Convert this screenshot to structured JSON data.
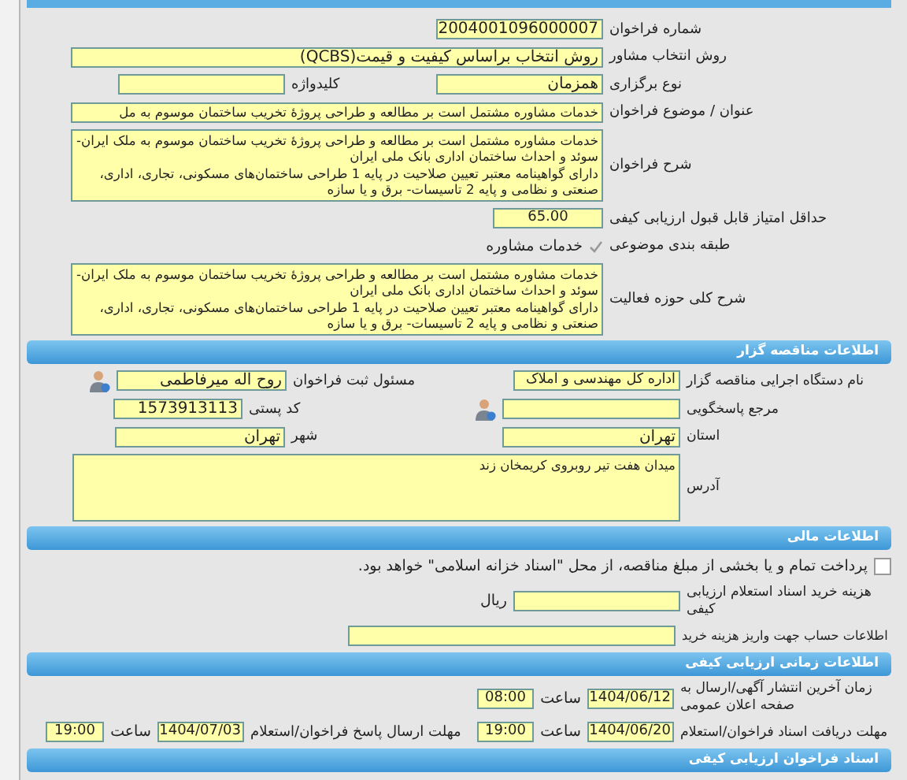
{
  "announcement": {
    "number": {
      "label": "شماره فراخوان",
      "value": "2004001096000007"
    },
    "selection_method": {
      "label": "روش انتخاب مشاور",
      "value": "روش انتخاب براساس کیفیت و قیمت(QCBS)"
    },
    "holding_type": {
      "label": "نوع برگزاری",
      "value": "همزمان"
    },
    "keyword": {
      "label": "کلیدواژه"
    },
    "subject": {
      "label": "عنوان / موضوع فراخوان",
      "value": "خدمات مشاوره مشتمل است بر مطالعه و طراحی پروژهٔ تخریب ساختمان موسوم به مل"
    },
    "description": {
      "label": "شرح فراخوان",
      "paragraphs": [
        "خدمات مشاوره مشتمل است بر مطالعه و طراحی پروژهٔ تخریب ساختمان موسوم به ملک ایران-سوئد و احداث ساختمان اداری بانک ملی ایران",
        "دارای گواهینامه معتبر تعیین صلاحیت در پایه 1 طراحی ساختمان‌های مسکونی، تجاری، اداری، صنعتی و نظامی و پایه 2 تاسیسات- برق و یا سازه"
      ]
    },
    "min_score": {
      "label": "حداقل امتیاز قابل قبول ارزیابی کیفی",
      "value": "65.00"
    },
    "category": {
      "label": "طبقه بندی موضوعی",
      "value": "خدمات مشاوره"
    },
    "activity_scope": {
      "label": "شرح کلی حوزه فعالیت",
      "paragraphs": [
        "خدمات مشاوره مشتمل است بر مطالعه و طراحی پروژهٔ تخریب ساختمان موسوم به ملک ایران-سوئد و احداث ساختمان اداری بانک ملی ایران",
        "دارای گواهینامه معتبر تعیین صلاحیت در پایه 1 طراحی ساختمان‌های مسکونی، تجاری، اداری، صنعتی و نظامی و پایه 2 تاسیسات- برق و یا سازه"
      ]
    }
  },
  "organizer": {
    "title": "اطلاعات مناقصه گزار",
    "agency": {
      "label": "نام دستگاه اجرایی مناقصه گزار",
      "value": "اداره کل مهندسی و املاک"
    },
    "registrar": {
      "label": "مسئول ثبت فراخوان",
      "value": "روح اله میرفاطمی"
    },
    "contact_ref": {
      "label": "مرجع پاسخگویی"
    },
    "postal_code": {
      "label": "کد پستی",
      "value": "1573913113"
    },
    "province": {
      "label": "استان",
      "value": "تهران"
    },
    "city": {
      "label": "شهر",
      "value": "تهران"
    },
    "address": {
      "label": "آدرس",
      "value": "میدان هفت تیر روبروی کریمخان زند"
    }
  },
  "financial": {
    "title": "اطلاعات مالی",
    "treasury_option": {
      "label": "پرداخت تمام و یا بخشی از مبلغ مناقصه، از محل \"اسناد خزانه اسلامی\" خواهد بود.",
      "checked": false
    },
    "document_fee": {
      "label_lines": [
        "هزینه خرید اسناد استعلام ارزیابی",
        "کیفی"
      ],
      "unit": "ریال"
    },
    "account_info": {
      "label": "اطلاعات حساب جهت واریز هزینه خرید"
    }
  },
  "schedule": {
    "title": "اطلاعات زمانی ارزیابی کیفی",
    "publish": {
      "label_lines": [
        "زمان آخرین انتشار آگهی/ارسال به",
        "صفحه اعلان عمومی"
      ],
      "date": "1404/06/12",
      "time_label": "ساعت",
      "time": "08:00"
    },
    "receive_deadline": {
      "label": "مهلت دریافت اسناد فراخوان/استعلام",
      "date": "1404/06/20",
      "time_label": "ساعت",
      "time": "19:00"
    },
    "response_deadline": {
      "label": "مهلت ارسال پاسخ فراخوان/استعلام",
      "date": "1404/07/03",
      "time_label": "ساعت",
      "time": "19:00"
    }
  },
  "documents": {
    "title": "اسناد فراخوان ارزیابی کیفی"
  }
}
